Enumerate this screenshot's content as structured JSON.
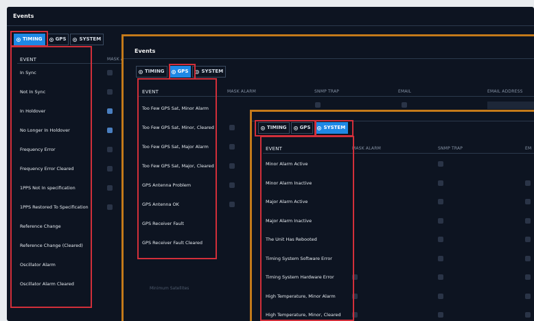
{
  "screen1": {
    "title": "Events",
    "tabs": [
      "TIMING",
      "GPS",
      "SYSTEM"
    ],
    "columns": {
      "event": "EVENT",
      "mask_alarm": "MASK AL"
    },
    "rows": [
      {
        "label": "In Sync",
        "mask": false
      },
      {
        "label": "Not In Sync",
        "mask": false
      },
      {
        "label": "In Holdover",
        "mask": true
      },
      {
        "label": "No Longer In Holdover",
        "mask": true
      },
      {
        "label": "Frequency Error",
        "mask": false
      },
      {
        "label": "Frequency Error Cleared",
        "mask": false
      },
      {
        "label": "1PPS Not In specification",
        "mask": false
      },
      {
        "label": "1PPS Restored To Specification",
        "mask": false
      },
      {
        "label": "Reference Change"
      },
      {
        "label": "Reference Change (Cleared)"
      },
      {
        "label": "Oscillator Alarm"
      },
      {
        "label": "Oscillator Alarm Cleared"
      }
    ]
  },
  "screen2": {
    "title": "Events",
    "tabs": [
      "TIMING",
      "GPS",
      "SYSTEM"
    ],
    "columns": {
      "event": "EVENT",
      "mask_alarm": "MASK ALARM",
      "snmp_trap": "SNMP TRAP",
      "email": "EMAIL",
      "email_address": "EMAIL ADDRESS"
    },
    "rows": [
      {
        "label": "Too Few GPS Sat, Minor Alarm"
      },
      {
        "label": "Too Few GPS Sat, Minor, Cleared"
      },
      {
        "label": "Too Few GPS Sat, Major Alarm"
      },
      {
        "label": "Too Few GPS Sat, Major, Cleared"
      },
      {
        "label": "GPS Antenna Problem"
      },
      {
        "label": "GPS Antenna OK"
      },
      {
        "label": "GPS Receiver Fault"
      },
      {
        "label": "GPS Receiver Fault Cleared"
      }
    ],
    "minimum_satellites_label": "Minimum Satellites"
  },
  "screen3": {
    "tabs": [
      "TIMING",
      "GPS",
      "SYSTEM"
    ],
    "columns": {
      "event": "EVENT",
      "mask_alarm": "MASK ALARM",
      "snmp_trap": "SNMP TRAP",
      "email": "EM"
    },
    "rows": [
      {
        "label": "Minor Alarm Active"
      },
      {
        "label": "Minor Alarm Inactive"
      },
      {
        "label": "Major Alarm Active"
      },
      {
        "label": "Major Alarm Inactive"
      },
      {
        "label": "The Unit Has Rebooted"
      },
      {
        "label": "Timing System Software Error"
      },
      {
        "label": "Timing System Hardware Error"
      },
      {
        "label": "High Temperature, Minor Alarm"
      },
      {
        "label": "High Temperature, Minor, Cleared"
      }
    ]
  },
  "colors": {
    "panel_bg": "#0d1421",
    "accent": "#1e88e5",
    "highlight": "#d32f3a",
    "frame": "#c47a1a"
  }
}
